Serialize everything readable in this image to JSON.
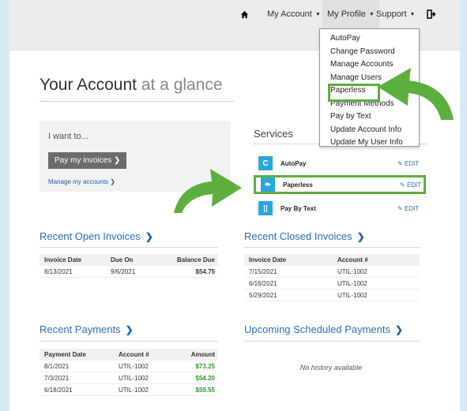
{
  "nav": {
    "home_icon": "home-icon",
    "my_account": "My Account",
    "my_profile": "My Profile",
    "support": "Support",
    "logout_icon": "logout-icon"
  },
  "dropdown": {
    "items": [
      {
        "label": "AutoPay"
      },
      {
        "label": "Change Password"
      },
      {
        "label": "Manage Accounts"
      },
      {
        "label": "Manage Users"
      },
      {
        "label": "Paperless"
      },
      {
        "label": "Payment Methods"
      },
      {
        "label": "Pay by Text"
      },
      {
        "label": "Update Account Info"
      },
      {
        "label": "Update My User Info"
      }
    ]
  },
  "page": {
    "title_main": "Your Account",
    "title_light": "at a glance"
  },
  "want": {
    "label": "I want to...",
    "pay_button": "Pay my invoices",
    "manage_link": "Manage my accounts"
  },
  "services": {
    "title": "Services",
    "items": [
      {
        "name": "AutoPay",
        "edit": "EDIT",
        "icon": "refresh-icon"
      },
      {
        "name": "Paperless",
        "edit": "EDIT",
        "icon": "leaf-icon"
      },
      {
        "name": "Pay By Text",
        "edit": "EDIT",
        "icon": "phone-icon"
      }
    ]
  },
  "open_invoices": {
    "title": "Recent Open Invoices",
    "headers": [
      "Invoice Date",
      "Due On",
      "Balance Due"
    ],
    "rows": [
      [
        "8/13/2021",
        "9/6/2021",
        "$54.75"
      ]
    ]
  },
  "closed_invoices": {
    "title": "Recent Closed Invoices",
    "headers": [
      "Invoice Date",
      "Account #"
    ],
    "rows": [
      [
        "7/15/2021",
        "UTIL-1002"
      ],
      [
        "6/16/2021",
        "UTIL-1002"
      ],
      [
        "5/29/2021",
        "UTIL-1002"
      ]
    ]
  },
  "payments": {
    "title": "Recent Payments",
    "headers": [
      "Payment Date",
      "Account #",
      "Amount"
    ],
    "rows": [
      [
        "8/1/2021",
        "UTIL-1002",
        "$73.25"
      ],
      [
        "7/3/2021",
        "UTIL-1002",
        "$54.20"
      ],
      [
        "6/18/2021",
        "UTIL-1002",
        "$59.55"
      ]
    ]
  },
  "scheduled": {
    "title": "Upcoming Scheduled Payments",
    "empty": "No history available"
  },
  "colors": {
    "accent_blue": "#2b6fb2",
    "service_icon": "#2aa6dc",
    "highlight_green": "#5daf3d",
    "amount_green": "#2d9a2a"
  }
}
